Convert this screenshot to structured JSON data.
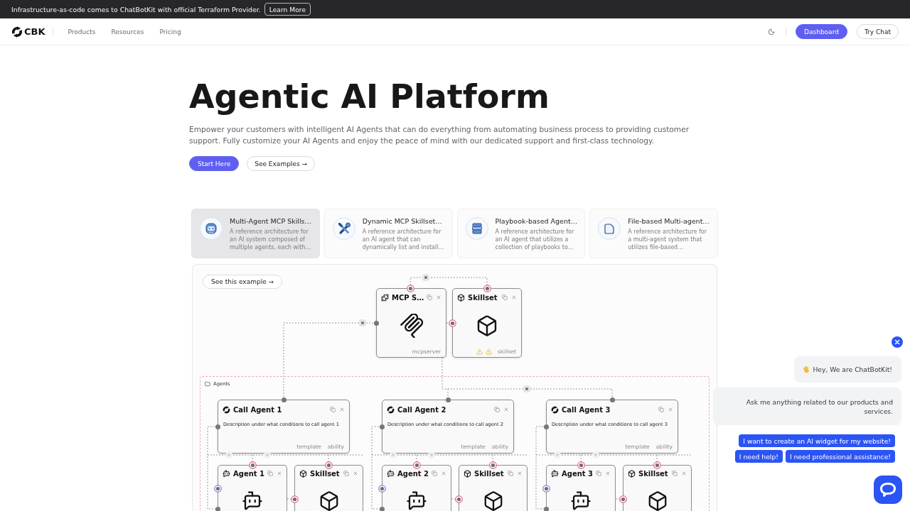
{
  "announcement": {
    "text": "Infrastructure-as-code comes to ChatBotKit with official Terraform Provider.",
    "button": "Learn More"
  },
  "nav": {
    "logo": "CBK",
    "links": [
      "Products",
      "Resources",
      "Pricing"
    ],
    "buttons": [
      {
        "label": "Dashboard",
        "kind": "primary"
      },
      {
        "label": "Try Chat",
        "kind": "outline"
      }
    ]
  },
  "hero": {
    "title": "Agentic AI Platform",
    "description": "Empower your customers with intelligent AI Agents that can do everything from automating business process to providing customer support. Fully customize your AI Agents and enjoy the peace of mind with our dedicated support and first-class technology.",
    "buttons": [
      {
        "label": "Start Here",
        "kind": "primary"
      },
      {
        "label": "See Examples →",
        "kind": "outline"
      }
    ]
  },
  "examples": [
    {
      "title": "Multi-Agent MCP Skills…",
      "description": "A reference architecture for an AI system composed of multiple agents, each with…",
      "selected": true
    },
    {
      "title": "Dynamic MCP Skillset…",
      "description": "A reference architecture for an AI agent that can dynamically list and install…",
      "selected": false
    },
    {
      "title": "Playbook-based Agent…",
      "description": "A reference architecture for an AI agent that utilizes a collection of playbooks to…",
      "selected": false
    },
    {
      "title": "File-based Multi-agent…",
      "description": "A reference architecture for a multi-agent system that utilizes file-based…",
      "selected": false
    }
  ],
  "diagram": {
    "button": "See this example →",
    "group": "Agents",
    "nodes": [
      {
        "kind": "mcpserver",
        "title": "MCP S…",
        "tags": [
          "mcpserver"
        ],
        "warning": false
      },
      {
        "kind": "skillset",
        "title": "Skillset",
        "tags": [
          "skillset"
        ],
        "warning": true
      },
      {
        "kind": "call_agent",
        "title": "Call Agent 1",
        "description": "Description under what conditions to call agent 1",
        "tags": [
          "template",
          "ability"
        ],
        "warning": false
      },
      {
        "kind": "call_agent",
        "title": "Call Agent 2",
        "description": "Description under what conditions to call agent 2",
        "tags": [
          "template",
          "ability"
        ],
        "warning": false
      },
      {
        "kind": "call_agent",
        "title": "Call Agent 3",
        "description": "Description under what conditions to call agent 3",
        "tags": [
          "template",
          "ability"
        ],
        "warning": false
      },
      {
        "kind": "agent",
        "title": "Agent 1"
      },
      {
        "kind": "skillset",
        "title": "Skillset"
      },
      {
        "kind": "agent",
        "title": "Agent 2"
      },
      {
        "kind": "skillset",
        "title": "Skillset"
      },
      {
        "kind": "agent",
        "title": "Agent 3"
      },
      {
        "kind": "skillset",
        "title": "Skillset"
      }
    ]
  },
  "chat": {
    "messages": [
      "Hey, We are ChatBotKit!",
      "Ask me anything related to our products and services."
    ],
    "suggestions": [
      "I want to create an AI widget for my website!",
      "I need help!",
      "I need professional assistance!"
    ]
  }
}
